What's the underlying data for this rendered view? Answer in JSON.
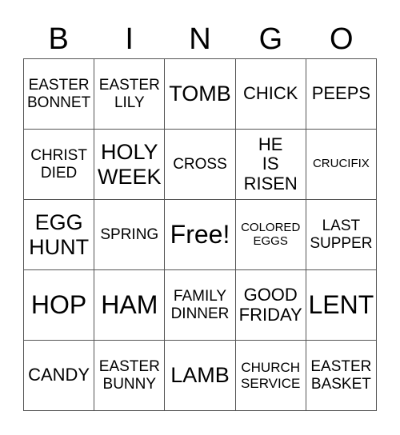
{
  "header": {
    "letters": [
      "B",
      "I",
      "N",
      "G",
      "O"
    ]
  },
  "cells": [
    "EASTER\nBONNET",
    "EASTER\nLILY",
    "TOMB",
    "CHICK",
    "PEEPS",
    "CHRIST\nDIED",
    "HOLY\nWEEK",
    "CROSS",
    "HE\nIS\nRISEN",
    "CRUCIFIX",
    "EGG\nHUNT",
    "SPRING",
    "Free!",
    "COLORED\nEGGS",
    "LAST\nSUPPER",
    "HOP",
    "HAM",
    "FAMILY\nDINNER",
    "GOOD\nFRIDAY",
    "LENT",
    "CANDY",
    "EASTER\nBUNNY",
    "LAMB",
    "CHURCH\nSERVICE",
    "EASTER\nBASKET"
  ]
}
